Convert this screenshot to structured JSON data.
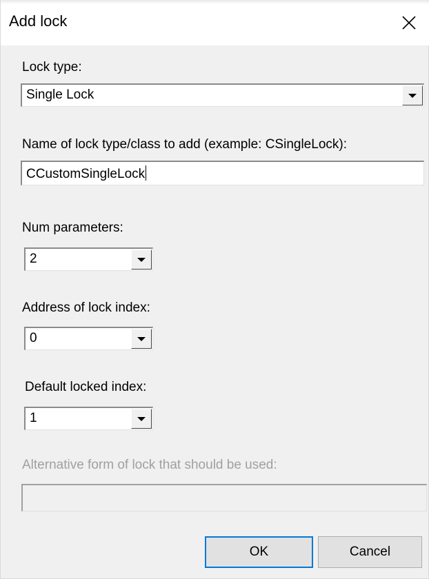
{
  "window": {
    "title": "Add lock",
    "close_glyph": "✕"
  },
  "lock_type": {
    "label": "Lock type:",
    "selected": "Single Lock"
  },
  "class_name": {
    "label": "Name of lock type/class to add (example: CSingleLock):",
    "value": "CCustomSingleLock"
  },
  "num_parameters": {
    "label": "Num parameters:",
    "selected": "2"
  },
  "lock_index_address": {
    "label": "Address of lock index:",
    "selected": "0"
  },
  "default_locked_index": {
    "label": "Default locked index:",
    "selected": "1"
  },
  "alternative_form": {
    "label": "Alternative form of lock that should be used:",
    "value": ""
  },
  "buttons": {
    "ok": "OK",
    "cancel": "Cancel"
  },
  "colors": {
    "default_button_border": "#0078d7",
    "disabled_text": "#a0a0a0",
    "dialog_bg": "#f0f0f0"
  }
}
